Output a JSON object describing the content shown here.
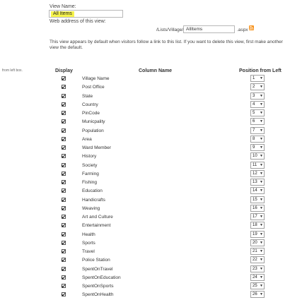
{
  "view": {
    "name_label": "View Name:",
    "name_value": "All Items",
    "web_address_label": "Web address of this view:",
    "url_prefix": "/Lists/Village/",
    "url_value": "AllItems",
    "url_ext": ".aspx",
    "default_note": "This view appears by default when visitors follow a link to this list. If you want to delete this view, first make another view the default.",
    "left_fragment": "from left box."
  },
  "columns": {
    "display_header": "Display",
    "column_header": "Column Name",
    "position_header": "Position from Left"
  },
  "rows": [
    {
      "name": "Village Name",
      "pos": "1"
    },
    {
      "name": "Post Office",
      "pos": "2"
    },
    {
      "name": "State",
      "pos": "3"
    },
    {
      "name": "Country",
      "pos": "4"
    },
    {
      "name": "PinCode",
      "pos": "5"
    },
    {
      "name": "Municpality",
      "pos": "6"
    },
    {
      "name": "Population",
      "pos": "7"
    },
    {
      "name": "Area",
      "pos": "8"
    },
    {
      "name": "Ward Member",
      "pos": "9"
    },
    {
      "name": "History",
      "pos": "10"
    },
    {
      "name": "Society",
      "pos": "11"
    },
    {
      "name": "Farming",
      "pos": "12"
    },
    {
      "name": "Fishing",
      "pos": "13"
    },
    {
      "name": "Education",
      "pos": "14"
    },
    {
      "name": "Handicrafts",
      "pos": "15"
    },
    {
      "name": "Weaving",
      "pos": "16"
    },
    {
      "name": "Art and Culture",
      "pos": "17"
    },
    {
      "name": "Entertainment",
      "pos": "18"
    },
    {
      "name": "Health",
      "pos": "19"
    },
    {
      "name": "Sports",
      "pos": "20"
    },
    {
      "name": "Travel",
      "pos": "21"
    },
    {
      "name": "Police Station",
      "pos": "22"
    },
    {
      "name": "SpentOnTravel",
      "pos": "23"
    },
    {
      "name": "SpentOnEducation",
      "pos": "24"
    },
    {
      "name": "SpentOnSports",
      "pos": "25"
    },
    {
      "name": "SpentOnHealth",
      "pos": "26"
    }
  ],
  "colors": {
    "highlight": "#f6f34c",
    "rss": "#f7931e"
  },
  "icons": {
    "rss": "rss-icon",
    "checkbox": "checkbox-checked-icon",
    "dropdown": "chevron-down-icon"
  }
}
